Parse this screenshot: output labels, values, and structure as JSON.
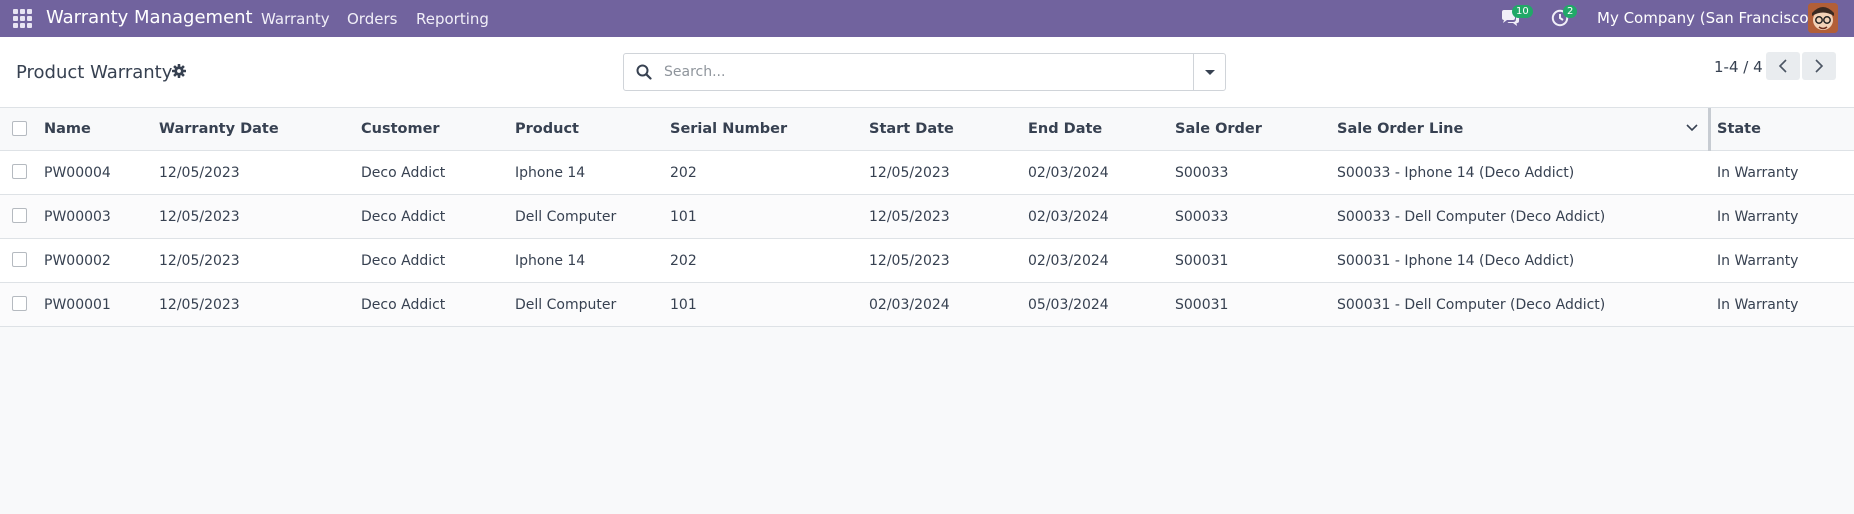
{
  "navbar": {
    "brand": "Warranty Management",
    "menu": [
      "Warranty",
      "Orders",
      "Reporting"
    ],
    "messages_count": "10",
    "activities_count": "2",
    "company": "My Company (San Francisco)",
    "color": "#71639e"
  },
  "control": {
    "title": "Product Warranty",
    "search_placeholder": "Search...",
    "pager": "1-4 / 4"
  },
  "table": {
    "columns": [
      "Name",
      "Warranty Date",
      "Customer",
      "Product",
      "Serial Number",
      "Start Date",
      "End Date",
      "Sale Order",
      "Sale Order Line",
      "State"
    ],
    "rows": [
      [
        "PW00004",
        "12/05/2023",
        "Deco Addict",
        "Iphone 14",
        "202",
        "12/05/2023",
        "02/03/2024",
        "S00033",
        "S00033 - Iphone 14 (Deco Addict)",
        "In Warranty"
      ],
      [
        "PW00003",
        "12/05/2023",
        "Deco Addict",
        "Dell Computer",
        "101",
        "12/05/2023",
        "02/03/2024",
        "S00033",
        "S00033 - Dell Computer (Deco Addict)",
        "In Warranty"
      ],
      [
        "PW00002",
        "12/05/2023",
        "Deco Addict",
        "Iphone 14",
        "202",
        "12/05/2023",
        "02/03/2024",
        "S00031",
        "S00031 - Iphone 14 (Deco Addict)",
        "In Warranty"
      ],
      [
        "PW00001",
        "12/05/2023",
        "Deco Addict",
        "Dell Computer",
        "101",
        "02/03/2024",
        "05/03/2024",
        "S00031",
        "S00031 - Dell Computer (Deco Addict)",
        "In Warranty"
      ]
    ]
  }
}
